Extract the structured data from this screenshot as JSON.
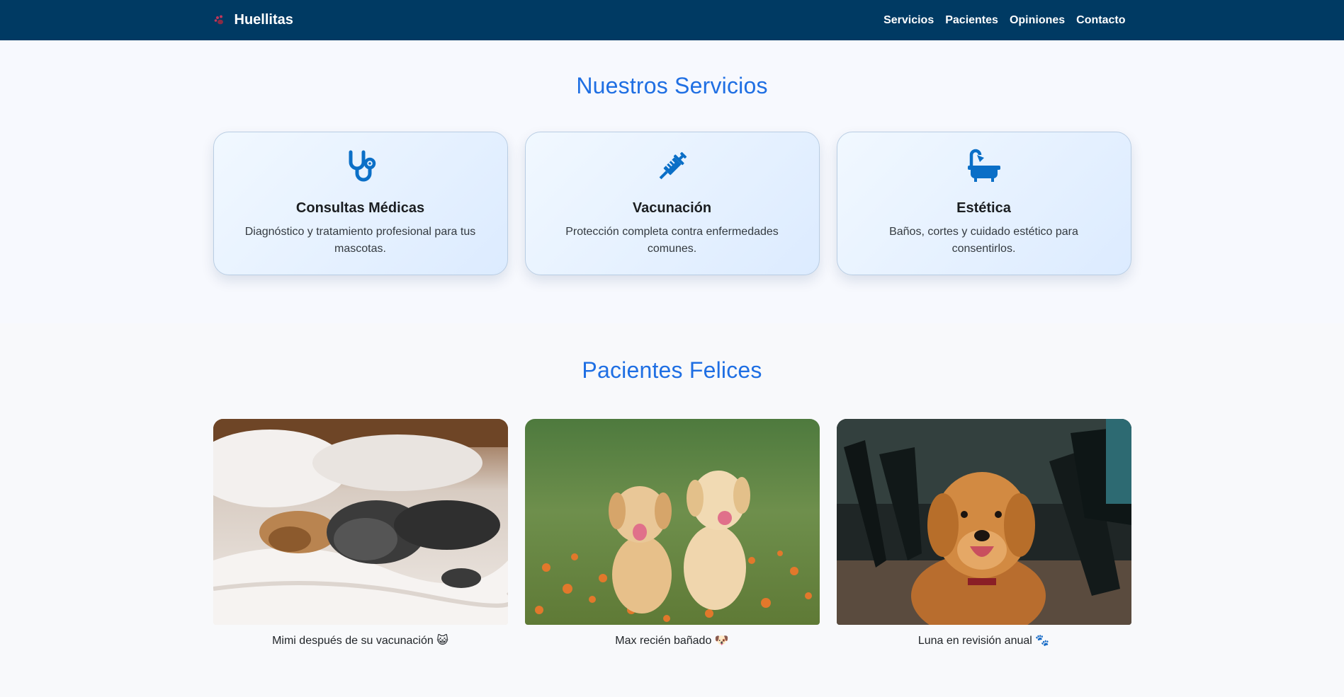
{
  "brand": {
    "name": "Huellitas",
    "icon": "paw-icon"
  },
  "nav": {
    "links": [
      "Servicios",
      "Pacientes",
      "Opiniones",
      "Contacto"
    ]
  },
  "services": {
    "title": "Nuestros Servicios",
    "cards": [
      {
        "icon": "stethoscope-icon",
        "title": "Consultas Médicas",
        "description": "Diagnóstico y tratamiento profesional para tus mascotas."
      },
      {
        "icon": "syringe-icon",
        "title": "Vacunación",
        "description": "Protección completa contra enfermedades comunes."
      },
      {
        "icon": "bath-icon",
        "title": "Estética",
        "description": "Baños, cortes y cuidado estético para consentirlos."
      }
    ]
  },
  "patients": {
    "title": "Pacientes Felices",
    "items": [
      {
        "caption": "Mimi después de su vacunación 😺"
      },
      {
        "caption": "Max recién bañado 🐶"
      },
      {
        "caption": "Luna en revisión anual 🐾"
      }
    ]
  },
  "colors": {
    "navbar": "#003a63",
    "accent": "#1f6fe3",
    "icon": "#0b6fc7"
  }
}
